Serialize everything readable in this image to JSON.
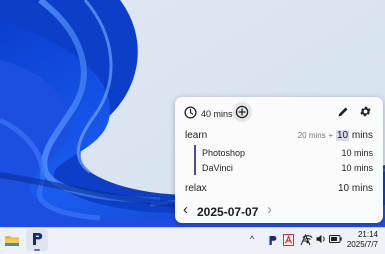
{
  "timer": {
    "label": "40 mins"
  },
  "entries": [
    {
      "name": "learn",
      "planned": "20 mins",
      "plus": "+",
      "extra_sel": "10",
      "extra_rest": " mins",
      "children": [
        {
          "name": "Photoshop",
          "duration": "10 mins"
        },
        {
          "name": "DaVinci",
          "duration": "10 mins"
        }
      ]
    },
    {
      "name": "relax",
      "duration": "10 mins"
    }
  ],
  "date_nav": {
    "date": "2025-07-07",
    "prev": "‹",
    "next": "›"
  },
  "taskbar": {
    "clock_time": "21:14",
    "clock_date": "2025/7/7",
    "chevron": "^"
  },
  "colors": {
    "accent": "#4c4c9c",
    "wallpaper_blue": "#1750d8",
    "panel_bg": "#fbfbfb"
  }
}
